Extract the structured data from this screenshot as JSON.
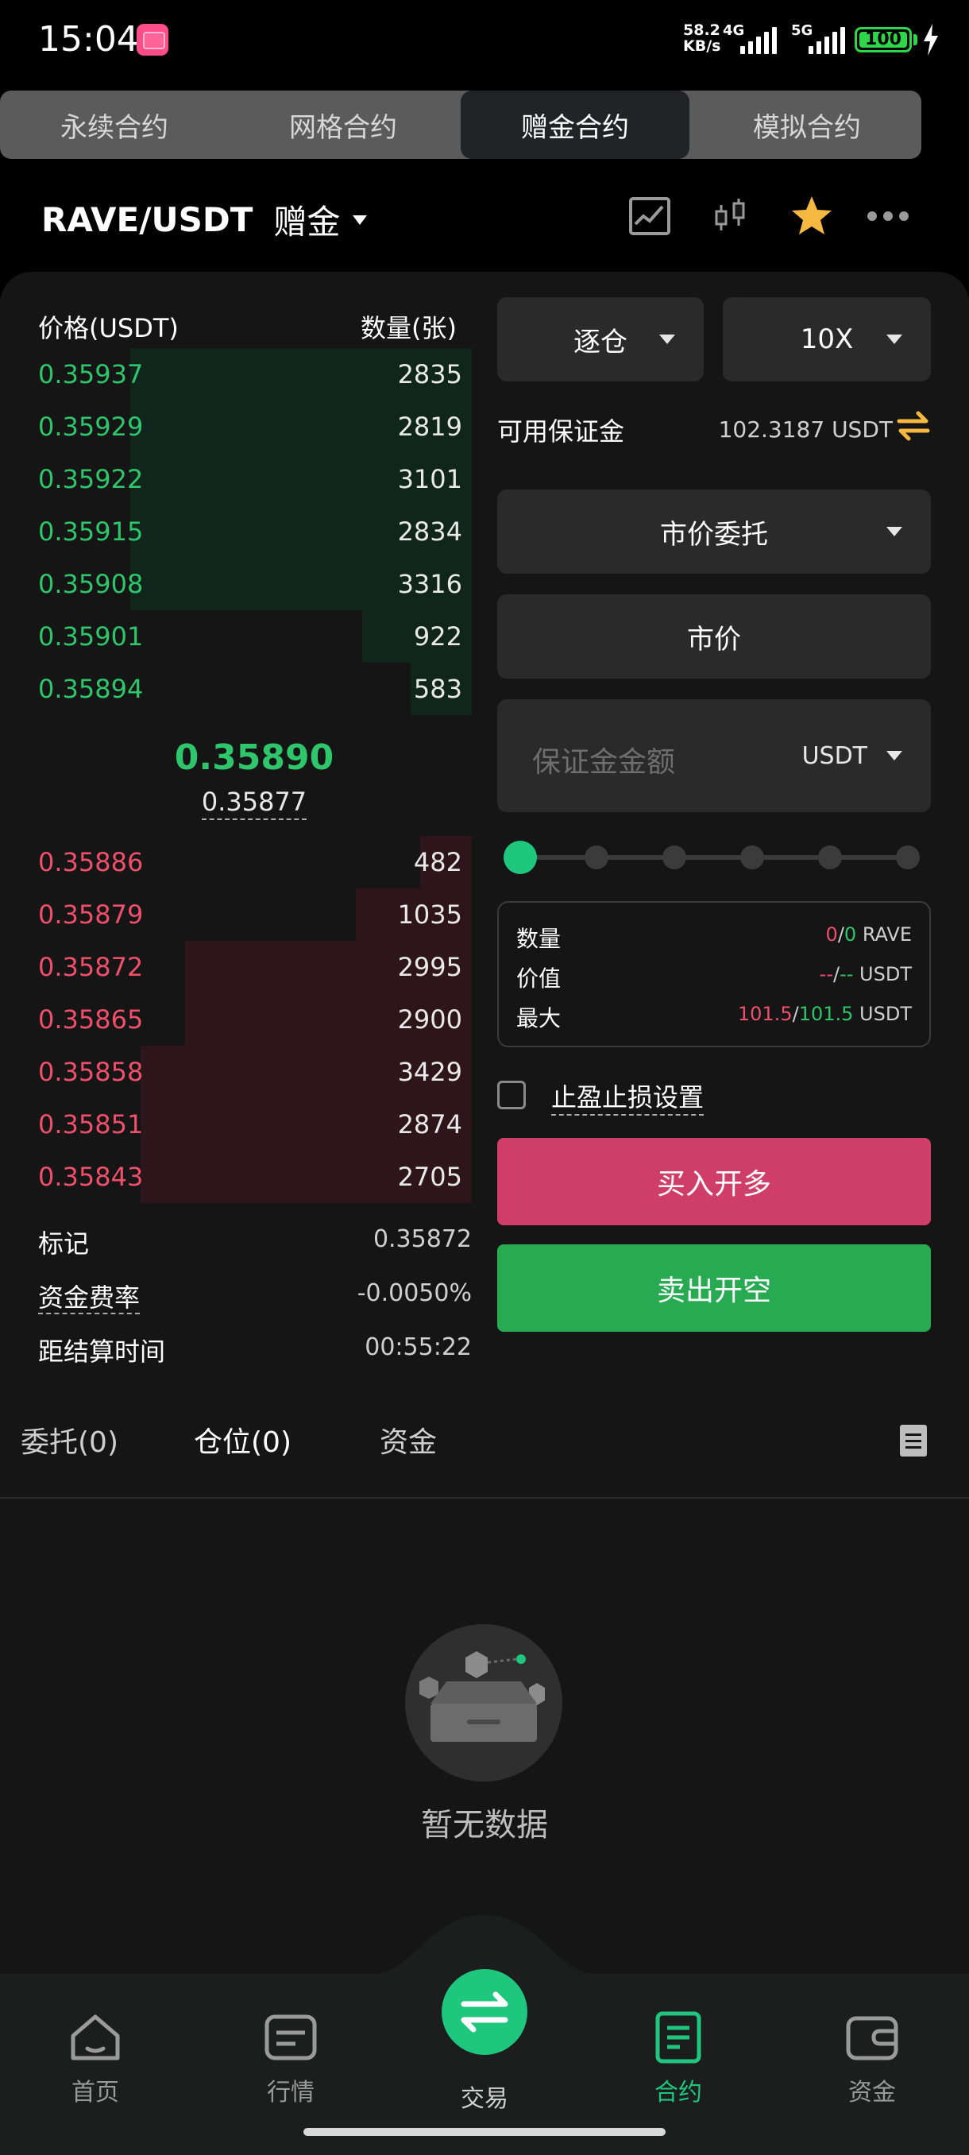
{
  "status": {
    "time": "15:04",
    "speed_value": "58.2",
    "speed_unit": "KB/s",
    "net1": "4G",
    "net2": "5G",
    "battery": "100"
  },
  "tabs": [
    {
      "label": "永续合约",
      "active": false
    },
    {
      "label": "网格合约",
      "active": false
    },
    {
      "label": "赠金合约",
      "active": true
    },
    {
      "label": "模拟合约",
      "active": false
    }
  ],
  "header": {
    "pair": "RAVE/USDT",
    "tag": "赠金"
  },
  "orderbook": {
    "price_header": "价格(USDT)",
    "qty_header": "数量(张)",
    "asks": [
      {
        "price": "0.35937",
        "qty": "2835",
        "depth": 1.0
      },
      {
        "price": "0.35929",
        "qty": "2819",
        "depth": 1.0
      },
      {
        "price": "0.35922",
        "qty": "3101",
        "depth": 1.0
      },
      {
        "price": "0.35915",
        "qty": "2834",
        "depth": 1.0
      },
      {
        "price": "0.35908",
        "qty": "3316",
        "depth": 1.0
      },
      {
        "price": "0.35901",
        "qty": "922",
        "depth": 0.32
      },
      {
        "price": "0.35894",
        "qty": "583",
        "depth": 0.18
      }
    ],
    "last_price": "0.35890",
    "mark_under": "0.35877",
    "bids": [
      {
        "price": "0.35886",
        "qty": "482",
        "depth": 0.15
      },
      {
        "price": "0.35879",
        "qty": "1035",
        "depth": 0.34
      },
      {
        "price": "0.35872",
        "qty": "2995",
        "depth": 0.84
      },
      {
        "price": "0.35865",
        "qty": "2900",
        "depth": 0.84
      },
      {
        "price": "0.35858",
        "qty": "3429",
        "depth": 0.97
      },
      {
        "price": "0.35851",
        "qty": "2874",
        "depth": 0.97
      },
      {
        "price": "0.35843",
        "qty": "2705",
        "depth": 0.97
      }
    ]
  },
  "info": {
    "mark_label": "标记",
    "mark_value": "0.35872",
    "funding_label": "资金费率",
    "funding_value": "-0.0050%",
    "settle_label": "距结算时间",
    "settle_value": "00:55:22"
  },
  "form": {
    "margin_mode": "逐仓",
    "leverage": "10X",
    "avail_label": "可用保证金",
    "avail_value": "102.3187 USDT",
    "order_type": "市价委托",
    "price_mode": "市价",
    "margin_placeholder": "保证金金额",
    "margin_unit": "USDT",
    "slider_percent": 0,
    "qty_label": "数量",
    "qty_a": "0",
    "qty_sep": "/",
    "qty_b": "0",
    "qty_unit": "RAVE",
    "value_label": "价值",
    "value_a": "--",
    "value_b": "--",
    "value_unit": "USDT",
    "max_label": "最大",
    "max_a": "101.5",
    "max_b": "101.5",
    "max_unit": "USDT",
    "tpsl_label": "止盈止损设置",
    "buy_label": "买入开多",
    "sell_label": "卖出开空"
  },
  "subtabs": {
    "orders": "委托(0)",
    "positions": "仓位(0)",
    "funds": "资金"
  },
  "empty_text": "暂无数据",
  "nav": {
    "home": "首页",
    "market": "行情",
    "trade": "交易",
    "contract": "合约",
    "assets": "资金"
  },
  "colors": {
    "green": "#2fc56b",
    "red": "#ef4f6b",
    "accent": "#1fc77e",
    "buy": "#cf3e68",
    "sell": "#27aa52"
  }
}
